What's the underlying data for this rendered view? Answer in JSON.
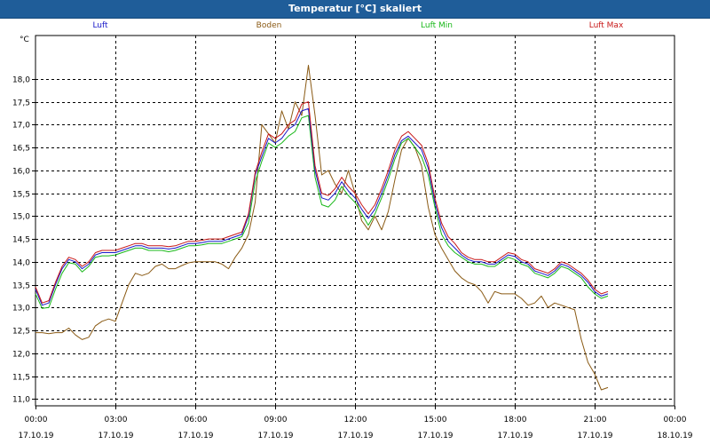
{
  "window": {
    "title": "Temperatur [°C] skaliert"
  },
  "colors": {
    "background": "#ffffff",
    "title_bar": "#1f5d99",
    "grid": "#000000",
    "luft": "#1818c8",
    "boden": "#8a5a14",
    "luft_min": "#18b818",
    "luft_max": "#c81818"
  },
  "chart_data": {
    "type": "line",
    "title": "Temperatur [°C] skaliert",
    "ylabel": "°C",
    "xlabel": "",
    "ylim": [
      10.85,
      18.95
    ],
    "xlim_hours": [
      0,
      24
    ],
    "grid": true,
    "legend_position": "top",
    "y_ticks": [
      "18,0",
      "17,5",
      "17,0",
      "16,5",
      "16,0",
      "15,5",
      "15,0",
      "14,5",
      "14,0",
      "13,5",
      "13,0",
      "12,5",
      "12,0",
      "11,5",
      "11,0"
    ],
    "x_ticks": [
      {
        "time": "00:00",
        "date": "17.10.19"
      },
      {
        "time": "03:00",
        "date": "17.10.19"
      },
      {
        "time": "06:00",
        "date": "17.10.19"
      },
      {
        "time": "09:00",
        "date": "17.10.19"
      },
      {
        "time": "12:00",
        "date": "17.10.19"
      },
      {
        "time": "15:00",
        "date": "17.10.19"
      },
      {
        "time": "18:00",
        "date": "17.10.19"
      },
      {
        "time": "21:00",
        "date": "17.10.19"
      },
      {
        "time": "00:00",
        "date": "18.10.19"
      }
    ],
    "x_hours": [
      0,
      0.25,
      0.5,
      0.75,
      1.0,
      1.25,
      1.5,
      1.75,
      2.0,
      2.25,
      2.5,
      2.75,
      3.0,
      3.25,
      3.5,
      3.75,
      4.0,
      4.25,
      4.5,
      4.75,
      5.0,
      5.25,
      5.5,
      5.75,
      6.0,
      6.25,
      6.5,
      6.75,
      7.0,
      7.25,
      7.5,
      7.75,
      8.0,
      8.25,
      8.5,
      8.75,
      9.0,
      9.25,
      9.5,
      9.75,
      10.0,
      10.25,
      10.5,
      10.75,
      11.0,
      11.25,
      11.5,
      11.75,
      12.0,
      12.25,
      12.5,
      12.75,
      13.0,
      13.25,
      13.5,
      13.75,
      14.0,
      14.25,
      14.5,
      14.75,
      15.0,
      15.25,
      15.5,
      15.75,
      16.0,
      16.25,
      16.5,
      16.75,
      17.0,
      17.25,
      17.5,
      17.75,
      18.0,
      18.25,
      18.5,
      18.75,
      19.0,
      19.25,
      19.5,
      19.75,
      20.0,
      20.25,
      20.5,
      20.75,
      21.0,
      21.25,
      21.5,
      21.75,
      22.0,
      22.25,
      22.5,
      22.75,
      23.0,
      23.25,
      23.5,
      23.75,
      24.0
    ],
    "series": [
      {
        "name": "Luft",
        "color": "#1818c8",
        "values": [
          13.4,
          13.05,
          13.1,
          13.5,
          13.85,
          14.05,
          14.0,
          13.85,
          13.95,
          14.15,
          14.2,
          14.2,
          14.2,
          14.25,
          14.3,
          14.35,
          14.35,
          14.3,
          14.3,
          14.3,
          14.28,
          14.3,
          14.35,
          14.4,
          14.4,
          14.42,
          14.45,
          14.45,
          14.45,
          14.5,
          14.55,
          14.6,
          15.0,
          15.9,
          16.3,
          16.7,
          16.6,
          16.7,
          16.9,
          17.0,
          17.3,
          17.35,
          16.0,
          15.4,
          15.35,
          15.5,
          15.75,
          15.55,
          15.4,
          15.15,
          14.95,
          15.15,
          15.5,
          15.9,
          16.35,
          16.65,
          16.75,
          16.6,
          16.45,
          16.05,
          15.3,
          14.75,
          14.45,
          14.3,
          14.15,
          14.05,
          14.0,
          14.0,
          13.95,
          13.95,
          14.05,
          14.15,
          14.12,
          14.0,
          13.95,
          13.8,
          13.75,
          13.7,
          13.8,
          13.95,
          13.9,
          13.8,
          13.7,
          13.55,
          13.35,
          13.25,
          13.3
        ]
      },
      {
        "name": "Boden",
        "color": "#8a5a14",
        "values": [
          12.45,
          12.45,
          12.43,
          12.45,
          12.45,
          12.55,
          12.4,
          12.3,
          12.35,
          12.6,
          12.7,
          12.75,
          12.7,
          13.1,
          13.5,
          13.75,
          13.7,
          13.75,
          13.9,
          13.95,
          13.85,
          13.85,
          13.92,
          13.98,
          14.0,
          14.0,
          14.0,
          14.0,
          13.95,
          13.85,
          14.1,
          14.3,
          14.6,
          15.3,
          17.0,
          16.8,
          16.6,
          17.3,
          16.9,
          17.5,
          17.2,
          18.3,
          17.2,
          15.9,
          16.0,
          15.7,
          15.5,
          16.0,
          15.5,
          14.9,
          14.7,
          15.0,
          14.7,
          15.1,
          15.8,
          16.45,
          16.7,
          16.5,
          16.1,
          15.2,
          14.6,
          14.3,
          14.05,
          13.8,
          13.65,
          13.55,
          13.5,
          13.35,
          13.1,
          13.35,
          13.3,
          13.3,
          13.3,
          13.2,
          13.05,
          13.1,
          13.25,
          13.0,
          13.1,
          13.05,
          13.0,
          12.95,
          12.3,
          11.8,
          11.55,
          11.2,
          11.25
        ]
      },
      {
        "name": "Luft Min",
        "color": "#18b818",
        "values": [
          13.3,
          12.98,
          13.0,
          13.4,
          13.75,
          13.98,
          13.95,
          13.78,
          13.9,
          14.1,
          14.13,
          14.13,
          14.15,
          14.2,
          14.25,
          14.3,
          14.3,
          14.25,
          14.25,
          14.25,
          14.22,
          14.25,
          14.3,
          14.35,
          14.35,
          14.37,
          14.4,
          14.4,
          14.4,
          14.45,
          14.5,
          14.55,
          14.85,
          15.75,
          16.2,
          16.6,
          16.5,
          16.6,
          16.75,
          16.85,
          17.15,
          17.2,
          15.85,
          15.25,
          15.2,
          15.35,
          15.65,
          15.45,
          15.3,
          15.05,
          14.8,
          15.05,
          15.4,
          15.8,
          16.25,
          16.6,
          16.7,
          16.5,
          16.3,
          15.9,
          15.2,
          14.6,
          14.35,
          14.2,
          14.1,
          14.0,
          13.95,
          13.95,
          13.9,
          13.9,
          14.0,
          14.1,
          14.05,
          13.95,
          13.9,
          13.75,
          13.7,
          13.65,
          13.75,
          13.9,
          13.85,
          13.75,
          13.65,
          13.45,
          13.3,
          13.2,
          13.25
        ]
      },
      {
        "name": "Luft Max",
        "color": "#c81818",
        "values": [
          13.45,
          13.1,
          13.15,
          13.55,
          13.9,
          14.1,
          14.05,
          13.9,
          14.0,
          14.2,
          14.25,
          14.25,
          14.25,
          14.3,
          14.35,
          14.4,
          14.4,
          14.35,
          14.35,
          14.35,
          14.33,
          14.35,
          14.4,
          14.45,
          14.45,
          14.47,
          14.5,
          14.5,
          14.5,
          14.55,
          14.6,
          14.65,
          15.05,
          15.95,
          16.4,
          16.8,
          16.7,
          16.8,
          17.0,
          17.1,
          17.45,
          17.5,
          16.1,
          15.5,
          15.45,
          15.6,
          15.85,
          15.65,
          15.5,
          15.25,
          15.05,
          15.25,
          15.6,
          16.0,
          16.45,
          16.75,
          16.85,
          16.7,
          16.55,
          16.15,
          15.4,
          14.85,
          14.55,
          14.4,
          14.2,
          14.1,
          14.05,
          14.05,
          14.0,
          14.0,
          14.1,
          14.2,
          14.17,
          14.05,
          14.0,
          13.85,
          13.8,
          13.75,
          13.85,
          14.0,
          13.95,
          13.85,
          13.75,
          13.6,
          13.4,
          13.3,
          13.35
        ]
      }
    ]
  }
}
